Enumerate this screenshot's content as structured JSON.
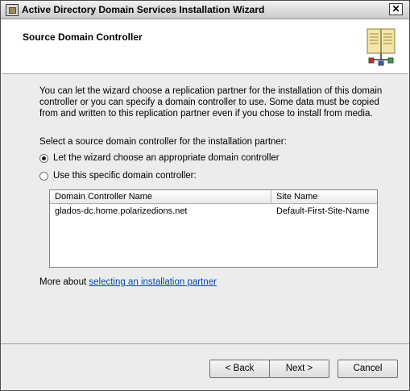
{
  "window": {
    "title": "Active Directory Domain Services Installation Wizard",
    "close_glyph": "✕"
  },
  "header": {
    "title": "Source Domain Controller"
  },
  "content": {
    "description": "You can let the wizard choose a replication partner for the installation of this domain controller or you can specify a domain controller to use. Some data must be copied from and written to this replication partner even if you chose to install from media.",
    "select_label": "Select a source domain controller for the installation partner:",
    "radio_options": [
      {
        "label": "Let the wizard choose an appropriate domain controller",
        "checked": true
      },
      {
        "label": "Use this specific domain controller:",
        "checked": false
      }
    ],
    "table": {
      "columns": [
        "Domain Controller Name",
        "Site Name"
      ],
      "rows": [
        [
          "glados-dc.home.polarizedions.net",
          "Default-First-Site-Name"
        ]
      ]
    },
    "more_about_prefix": "More about ",
    "more_about_link": "selecting an installation partner"
  },
  "buttons": {
    "back": "< Back",
    "next": "Next >",
    "cancel": "Cancel"
  },
  "icons": {
    "title_icon": "wizard-app-icon",
    "header_icon": "directory-book-icon",
    "close_icon": "close-icon"
  }
}
